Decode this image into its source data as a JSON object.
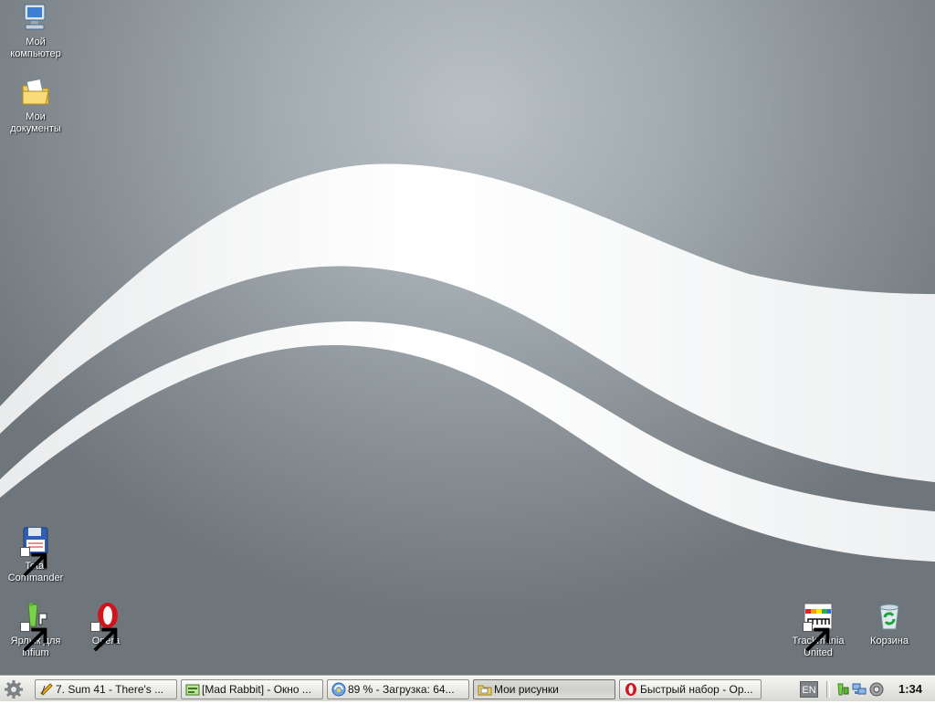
{
  "desktop": {
    "icons": [
      {
        "label": "Мой компьютер",
        "icon": "computer-icon"
      },
      {
        "label": "Мои документы",
        "icon": "documents-folder-icon"
      },
      {
        "label": "Total Commander",
        "icon": "floppy-disk-icon"
      },
      {
        "label": "Ярлык для infium",
        "icon": "infium-icon"
      },
      {
        "label": "Opera",
        "icon": "opera-icon"
      },
      {
        "label": "Trackmania United",
        "icon": "trackmania-icon"
      },
      {
        "label": "Корзина",
        "icon": "recycle-bin-icon"
      }
    ]
  },
  "taskbar": {
    "start_icon": "start-gear-icon",
    "tasks": [
      {
        "label": "7. Sum 41 - There's ...",
        "icon": "winamp-icon",
        "active": false
      },
      {
        "label": "[Mad Rabbit] - Окно ...",
        "icon": "chat-window-icon",
        "active": false
      },
      {
        "label": "89 % - Загрузка: 64...",
        "icon": "download-icon",
        "active": false
      },
      {
        "label": "Мои рисунки",
        "icon": "folder-icon",
        "active": true
      },
      {
        "label": "Быстрый набор - Op...",
        "icon": "opera-icon",
        "active": false
      }
    ],
    "language": "EN",
    "tray": [
      "infium-tray-icon",
      "network-tray-icon",
      "volume-tray-icon"
    ],
    "clock": "1:34"
  },
  "colors": {
    "wallpaper": "#9aa3a8",
    "wave": "#f4f5f5",
    "taskbar": "#e6e6e3"
  }
}
